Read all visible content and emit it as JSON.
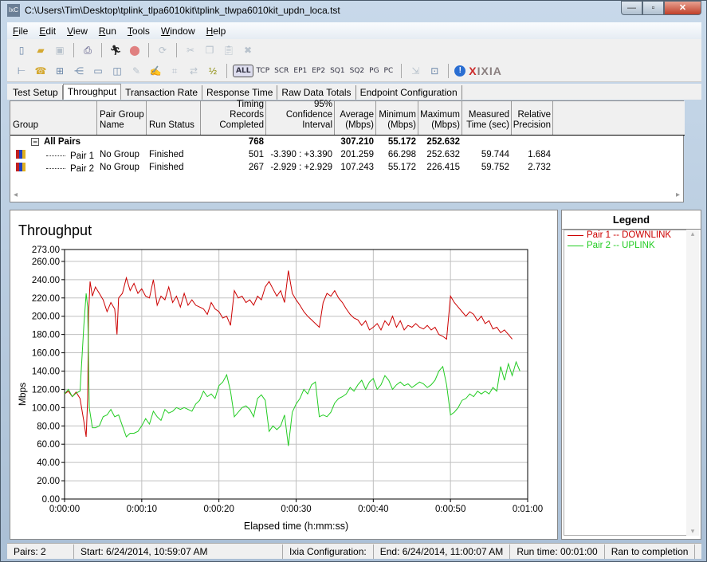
{
  "window": {
    "title": "C:\\Users\\Tim\\Desktop\\tplink_tlpa6010kit\\tplink_tlwpa6010kit_updn_loca.tst",
    "app_icon": "ixchariot-app-icon",
    "controls": {
      "minimize": "—",
      "maximize": "▫",
      "close": "✕"
    }
  },
  "menu": [
    {
      "label": "File",
      "key": "F",
      "rest": "ile"
    },
    {
      "label": "Edit",
      "key": "E",
      "rest": "dit"
    },
    {
      "label": "View",
      "key": "V",
      "rest": "iew"
    },
    {
      "label": "Run",
      "key": "R",
      "rest": "un"
    },
    {
      "label": "Tools",
      "key": "T",
      "rest": "ools"
    },
    {
      "label": "Window",
      "key": "W",
      "rest": "indow"
    },
    {
      "label": "Help",
      "key": "H",
      "rest": "elp"
    }
  ],
  "toolbar": {
    "row2_filters": [
      "ALL",
      "TCP",
      "SCR",
      "EP1",
      "EP2",
      "SQ1",
      "SQ2",
      "PG",
      "PC"
    ],
    "selected_filter": "ALL",
    "brand": "IXIA",
    "brand_x": "X"
  },
  "tabs": [
    {
      "label": "Test Setup",
      "active": false
    },
    {
      "label": "Throughput",
      "active": true
    },
    {
      "label": "Transaction Rate",
      "active": false
    },
    {
      "label": "Response Time",
      "active": false
    },
    {
      "label": "Raw Data Totals",
      "active": false
    },
    {
      "label": "Endpoint Configuration",
      "active": false
    }
  ],
  "results_table": {
    "columns": [
      "Group",
      "Pair Group Name",
      "Run Status",
      "Timing Records Completed",
      "95% Confidence Interval",
      "Average (Mbps)",
      "Minimum (Mbps)",
      "Maximum (Mbps)",
      "Measured Time (sec)",
      "Relative Precision"
    ],
    "summary": {
      "label": "All Pairs",
      "expander": "−",
      "timing_records": "768",
      "average": "307.210",
      "minimum": "55.172",
      "maximum": "252.632"
    },
    "rows": [
      {
        "pair": "Pair 1",
        "group_name": "No Group",
        "status": "Finished",
        "records": "501",
        "ci": "-3.390 : +3.390",
        "avg": "201.259",
        "min": "66.298",
        "max": "252.632",
        "time": "59.744",
        "precision": "1.684"
      },
      {
        "pair": "Pair 2",
        "group_name": "No Group",
        "status": "Finished",
        "records": "267",
        "ci": "-2.929 : +2.929",
        "avg": "107.243",
        "min": "55.172",
        "max": "226.415",
        "time": "59.752",
        "precision": "2.732"
      }
    ]
  },
  "legend": {
    "title": "Legend",
    "items": [
      {
        "label": "Pair 1 -- DOWNLINK",
        "color": "#cc0000"
      },
      {
        "label": "Pair 2 -- UPLINK",
        "color": "#22cc22"
      }
    ]
  },
  "status_bar": {
    "pairs": "Pairs: 2",
    "start": "Start: 6/24/2014, 10:59:07 AM",
    "config": "Ixia Configuration:",
    "end": "End: 6/24/2014, 11:00:07 AM",
    "run_time": "Run time: 00:01:00",
    "result": "Ran to completion"
  },
  "chart_data": {
    "type": "line",
    "title": "Throughput",
    "xlabel": "Elapsed time (h:mm:ss)",
    "ylabel": "Mbps",
    "xlim": [
      0,
      60
    ],
    "ylim": [
      0,
      273
    ],
    "x_ticks": [
      0,
      10,
      20,
      30,
      40,
      50,
      60
    ],
    "x_tick_labels": [
      "0:00:00",
      "0:00:10",
      "0:00:20",
      "0:00:30",
      "0:00:40",
      "0:00:50",
      "0:01:00"
    ],
    "y_ticks": [
      0,
      20,
      40,
      60,
      80,
      100,
      120,
      140,
      160,
      180,
      200,
      220,
      240,
      260,
      273
    ],
    "y_tick_labels": [
      "0.00",
      "20.00",
      "40.00",
      "60.00",
      "80.00",
      "100.00",
      "120.00",
      "140.00",
      "160.00",
      "180.00",
      "200.00",
      "220.00",
      "240.00",
      "260.00",
      "273.00"
    ],
    "grid": true,
    "legend_position": "right-panel",
    "series": [
      {
        "name": "Pair 1 -- DOWNLINK",
        "color": "#cc0000",
        "x": [
          0,
          0.5,
          1,
          1.5,
          2,
          2.5,
          2.8,
          3.0,
          3.1,
          3.3,
          3.6,
          4,
          4.5,
          5,
          5.5,
          6,
          6.5,
          6.8,
          7,
          7.5,
          8,
          8.5,
          9,
          9.5,
          10,
          10.5,
          11,
          11.5,
          12,
          12.5,
          13,
          13.5,
          14,
          14.5,
          15,
          15.5,
          16,
          16.5,
          17,
          17.5,
          18,
          18.5,
          19,
          19.5,
          20,
          20.5,
          21,
          21.5,
          22,
          22.5,
          23,
          23.5,
          24,
          24.5,
          25,
          25.5,
          26,
          26.5,
          27,
          27.5,
          28,
          28.5,
          29,
          29.5,
          30,
          30.5,
          31,
          31.5,
          32,
          32.5,
          33,
          33.5,
          34,
          34.5,
          35,
          35.5,
          36,
          36.5,
          37,
          37.5,
          38,
          38.5,
          39,
          39.5,
          40,
          40.5,
          41,
          41.5,
          42,
          42.5,
          43,
          43.5,
          44,
          44.5,
          45,
          45.5,
          46,
          46.5,
          47,
          47.5,
          48,
          48.5,
          49,
          49.5,
          50,
          50.5,
          51,
          51.5,
          52,
          52.5,
          53,
          53.5,
          54,
          54.5,
          55,
          55.5,
          56,
          56.5,
          57,
          57.5,
          58,
          58.5,
          59,
          59.5,
          60
        ],
        "y": [
          115,
          118,
          112,
          117,
          110,
          85,
          68,
          110,
          200,
          238,
          222,
          232,
          225,
          218,
          205,
          215,
          208,
          180,
          220,
          225,
          242,
          228,
          236,
          225,
          230,
          222,
          220,
          240,
          212,
          222,
          218,
          232,
          215,
          222,
          210,
          225,
          212,
          218,
          212,
          210,
          208,
          202,
          215,
          208,
          205,
          198,
          200,
          190,
          228,
          220,
          222,
          215,
          218,
          212,
          222,
          218,
          232,
          238,
          230,
          222,
          228,
          215,
          250,
          225,
          218,
          212,
          205,
          200,
          196,
          192,
          188,
          215,
          225,
          222,
          228,
          220,
          215,
          208,
          202,
          198,
          196,
          190,
          195,
          185,
          188,
          192,
          185,
          195,
          190,
          200,
          188,
          195,
          185,
          190,
          188,
          192,
          188,
          186,
          190,
          185,
          188,
          180,
          178,
          175,
          222,
          215,
          210,
          205,
          200,
          205,
          202,
          195,
          200,
          192,
          195,
          186,
          188,
          182,
          185,
          180,
          175
        ]
      },
      {
        "name": "Pair 2 -- UPLINK",
        "color": "#22cc22",
        "x": [
          0,
          0.5,
          1,
          1.5,
          2,
          2.5,
          2.8,
          3.0,
          3.2,
          3.6,
          4,
          4.5,
          5,
          5.5,
          6,
          6.5,
          7,
          7.5,
          8,
          8.5,
          9,
          9.5,
          10,
          10.5,
          11,
          11.5,
          12,
          12.5,
          13,
          13.5,
          14,
          14.5,
          15,
          15.5,
          16,
          16.5,
          17,
          17.5,
          18,
          18.5,
          19,
          19.5,
          20,
          20.5,
          21,
          21.5,
          22,
          22.5,
          23,
          23.5,
          24,
          24.5,
          25,
          25.5,
          26,
          26.5,
          27,
          27.5,
          28,
          28.5,
          29,
          29.5,
          30,
          30.5,
          31,
          31.5,
          32,
          32.5,
          33,
          33.5,
          34,
          34.5,
          35,
          35.5,
          36,
          36.5,
          37,
          37.5,
          38,
          38.5,
          39,
          39.5,
          40,
          40.5,
          41,
          41.5,
          42,
          42.5,
          43,
          43.5,
          44,
          44.5,
          45,
          45.5,
          46,
          46.5,
          47,
          47.5,
          48,
          48.5,
          49,
          49.5,
          50,
          50.5,
          51,
          51.5,
          52,
          52.5,
          53,
          53.5,
          54,
          54.5,
          55,
          55.5,
          56,
          56.5,
          57,
          57.5,
          58,
          58.5,
          59,
          59.5,
          60
        ],
        "y": [
          115,
          120,
          112,
          116,
          118,
          190,
          225,
          210,
          100,
          78,
          78,
          80,
          90,
          92,
          98,
          90,
          92,
          80,
          68,
          72,
          72,
          74,
          80,
          88,
          82,
          96,
          90,
          86,
          98,
          94,
          96,
          100,
          98,
          100,
          98,
          96,
          104,
          108,
          118,
          112,
          115,
          110,
          124,
          128,
          136,
          118,
          90,
          95,
          100,
          102,
          98,
          90,
          110,
          114,
          108,
          74,
          80,
          76,
          80,
          92,
          58,
          95,
          104,
          110,
          120,
          115,
          125,
          128,
          90,
          92,
          90,
          95,
          105,
          110,
          112,
          115,
          122,
          118,
          125,
          130,
          120,
          128,
          132,
          120,
          125,
          135,
          130,
          120,
          125,
          128,
          124,
          126,
          122,
          125,
          128,
          126,
          122,
          125,
          130,
          140,
          145,
          125,
          92,
          95,
          100,
          108,
          110,
          115,
          112,
          118,
          115,
          118,
          115,
          122,
          118,
          145,
          130,
          148,
          135,
          150,
          140
        ]
      }
    ]
  }
}
